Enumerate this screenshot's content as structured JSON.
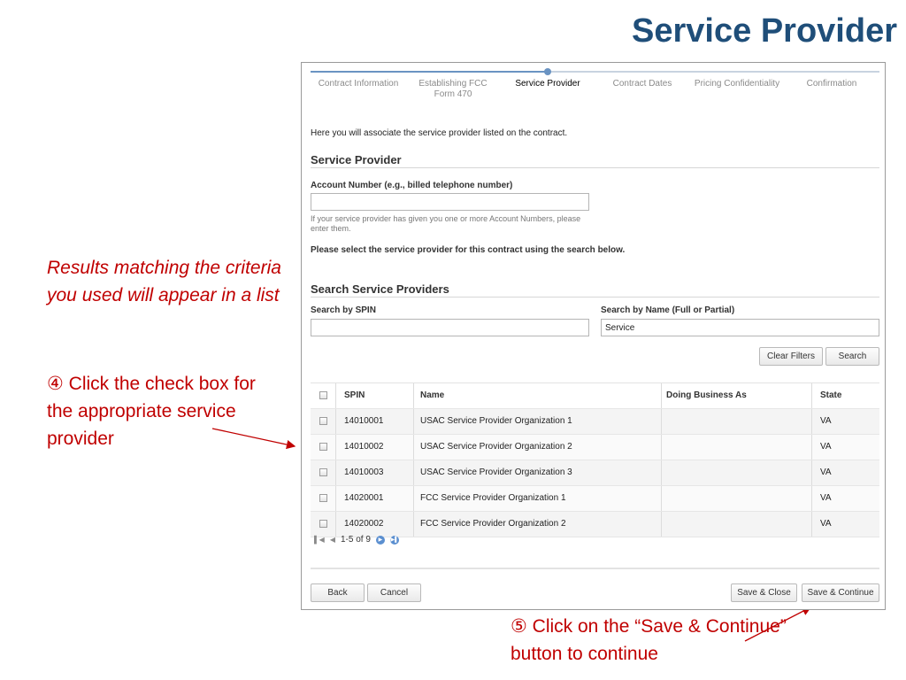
{
  "slide": {
    "title": "Service Provider",
    "note_results": "Results matching the criteria you used will appear in a list",
    "note_step4_num": "④",
    "note_step4": "Click the check box for the appropriate service provider",
    "note_step5_num": "⑤",
    "note_step5": "Click on the “Save & Continue” button to continue"
  },
  "progress": {
    "steps": [
      "Contract Information",
      "Establishing FCC Form 470",
      "Service Provider",
      "Contract Dates",
      "Pricing Confidentiality",
      "Confirmation"
    ],
    "active_index": 2
  },
  "form": {
    "intro": "Here you will associate the service provider listed on the contract.",
    "section_title": "Service Provider",
    "account_label": "Account Number (e.g., billed telephone number)",
    "account_value": "",
    "account_hint": "If your service provider has given you one or more Account Numbers, please enter them.",
    "select_instruction": "Please select the service provider for this contract using the search below."
  },
  "search": {
    "section_title": "Search Service Providers",
    "spin_label": "Search by SPIN",
    "spin_value": "",
    "name_label": "Search by Name (Full or Partial)",
    "name_value": "Service",
    "clear_label": "Clear Filters",
    "search_label": "Search"
  },
  "table": {
    "columns": [
      "SPIN",
      "Name",
      "Doing Business As",
      "State"
    ],
    "rows": [
      {
        "spin": "14010001",
        "name": "USAC Service Provider Organization 1",
        "dba": "",
        "state": "VA"
      },
      {
        "spin": "14010002",
        "name": "USAC Service Provider Organization 2",
        "dba": "",
        "state": "VA"
      },
      {
        "spin": "14010003",
        "name": "USAC Service Provider Organization 3",
        "dba": "",
        "state": "VA"
      },
      {
        "spin": "14020001",
        "name": "FCC Service Provider Organization 1",
        "dba": "",
        "state": "VA"
      },
      {
        "spin": "14020002",
        "name": "FCC Service Provider Organization 2",
        "dba": "",
        "state": "VA"
      }
    ],
    "pager_text": "1-5 of 9"
  },
  "footer": {
    "back": "Back",
    "cancel": "Cancel",
    "save_close": "Save & Close",
    "save_continue": "Save & Continue"
  },
  "colors": {
    "title": "#1f4e79",
    "annotation": "#c00000",
    "progress": "#6a93c2"
  },
  "icons": {
    "pager_first": "first-page-icon",
    "pager_prev": "prev-page-icon",
    "pager_next": "next-page-icon",
    "pager_last": "last-page-icon"
  }
}
